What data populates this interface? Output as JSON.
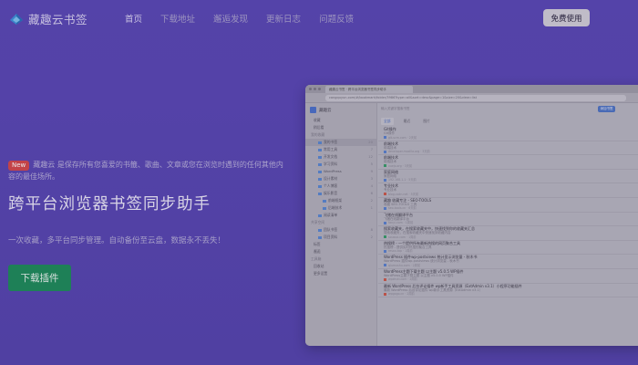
{
  "app": {
    "name": "藏趣云书签"
  },
  "nav": {
    "items": [
      {
        "label": "首页",
        "active": true
      },
      {
        "label": "下载地址",
        "active": false
      },
      {
        "label": "邂逅发现",
        "active": false
      },
      {
        "label": "更新日志",
        "active": false
      },
      {
        "label": "问题反馈",
        "active": false
      }
    ],
    "cta_label": "免费使用"
  },
  "hero": {
    "badge": "New",
    "intro": "藏趣云 是保存所有您喜爱的书籤、歌曲、文章或您在浏览时遇到的任何其他内容的最佳场所。",
    "title": "跨平台浏览器书签同步助手",
    "subtitle": "一次收藏，多平台同步管理。自动备份至云盘，数据永不丢失！",
    "download_label": "下载插件"
  },
  "browser": {
    "tab_title": "藏趣云书签 · 跨平台浏览器书签同步助手",
    "url": "cangquyun.com/#/bookmark/folder/3986?type=all&sort=desc&page=1&size=20&view=list",
    "sidebar": {
      "title": "藏趣云",
      "items": [
        {
          "label": "收藏",
          "level": 1,
          "sel": false,
          "count": ""
        },
        {
          "label": "稍后看",
          "level": 1,
          "sel": false,
          "count": ""
        },
        {
          "label": "我的收藏",
          "level": 0,
          "sel": false,
          "count": "",
          "section": true
        },
        {
          "label": "我的书签",
          "level": 2,
          "sel": true,
          "count": "20"
        },
        {
          "label": "常用工具",
          "level": 2,
          "sel": false,
          "count": "7"
        },
        {
          "label": "开发文档",
          "level": 2,
          "sel": false,
          "count": "12"
        },
        {
          "label": "学习资料",
          "level": 2,
          "sel": false,
          "count": "5"
        },
        {
          "label": "WordPress",
          "level": 2,
          "sel": false,
          "count": "9"
        },
        {
          "label": "设计素材",
          "level": 2,
          "sel": false,
          "count": "3"
        },
        {
          "label": "个人博客",
          "level": 2,
          "sel": false,
          "count": "4"
        },
        {
          "label": "娱乐影音",
          "level": 2,
          "sel": false,
          "count": "6"
        },
        {
          "label": "前端框架",
          "level": 3,
          "sel": false,
          "count": "2"
        },
        {
          "label": "后端技术",
          "level": 3,
          "sel": false,
          "count": "1"
        },
        {
          "label": "阅读清单",
          "level": 2,
          "sel": false,
          "count": ""
        },
        {
          "label": "共享空间",
          "level": 0,
          "sel": false,
          "count": "",
          "section": true
        },
        {
          "label": "团队书签",
          "level": 2,
          "sel": false,
          "count": "8"
        },
        {
          "label": "项目资料",
          "level": 2,
          "sel": false,
          "count": "2"
        },
        {
          "label": "标签",
          "level": 1,
          "sel": false,
          "count": ""
        },
        {
          "label": "邂逅",
          "level": 1,
          "sel": false,
          "count": ""
        },
        {
          "label": "工具箱",
          "level": 0,
          "sel": false,
          "count": "",
          "section": true
        },
        {
          "label": "回收站",
          "level": 1,
          "sel": false,
          "count": ""
        },
        {
          "label": "更多设置",
          "level": 1,
          "sel": false,
          "count": ""
        }
      ]
    },
    "search_placeholder": "输入关键字搜索书签",
    "new_label": "添加书签",
    "tabs": [
      "全部",
      "最近",
      "图片"
    ],
    "entries": [
      {
        "title": "Git操作",
        "desc": "Git操作",
        "meta": "git-scm.com · 2天前",
        "fav": "b"
      },
      {
        "title": "前端技术",
        "desc": "前端技术",
        "meta": "developer.mozilla.org · 3天前",
        "fav": "b"
      },
      {
        "title": "前端技术",
        "desc": "前端技术",
        "meta": "vuejs.org · 3天前",
        "fav": "g"
      },
      {
        "title": "家庭网络",
        "desc": "家庭网络",
        "meta": "192.168.1.1 · 5天前",
        "fav": "b"
      },
      {
        "title": "专业技术",
        "desc": "专业技术",
        "meta": "blog.csdn.net · 5天前",
        "fav": "r"
      },
      {
        "title": "藏趣 收藏专注 - SEO-TOOLS",
        "desc": "收藏 SEO-TOOLS 工具",
        "meta": "seo-tools.cn · 6天前",
        "fav": "b"
      },
      {
        "title": "飞猪在线翻译平台",
        "desc": "飞猪在线翻译平台",
        "meta": "fanyi.com · 1周前",
        "fav": "b"
      },
      {
        "title": "搜索收藏夹，在搜索收藏夹中，快速找到你的收藏夹汇总",
        "desc": "搜索收藏夹，在搜索收藏夹中快速找到收藏内容",
        "meta": "sousuo.com · 1周前",
        "fav": "g"
      },
      {
        "title": "热搜榜 - 一个提供所有最新热搜的网页聚合工具",
        "desc": "热搜榜 - 提供实时热搜的聚合工具",
        "meta": "resou.top · 1周前",
        "fav": "b"
      },
      {
        "title": "WordPress 插件wp-postviews 统计显示浏览量 - 秋木书",
        "desc": "WordPress 插件wp-postviews 统计浏览量 - 秋木书",
        "meta": "qiumushu.com · 2周前",
        "fav": "b"
      },
      {
        "title": "WordPress主题下载主题 以主题 v5.0.5 WP插件",
        "desc": "WordPress主题下载主题 以主题 v5.0.5 WP插件",
        "meta": "wpzhuti.com · 2周前",
        "fav": "r"
      },
      {
        "title": "最新 WordPress 后台评论插件 wp新手工具资源（ExtAdmin v3.1）小程序功能插件",
        "desc": "最新 WordPress 后台评论插件 wp新手工具资源（ExtAdmin v3.1）",
        "meta": "wpgogo.cn · 2周前",
        "fav": "r"
      }
    ]
  }
}
